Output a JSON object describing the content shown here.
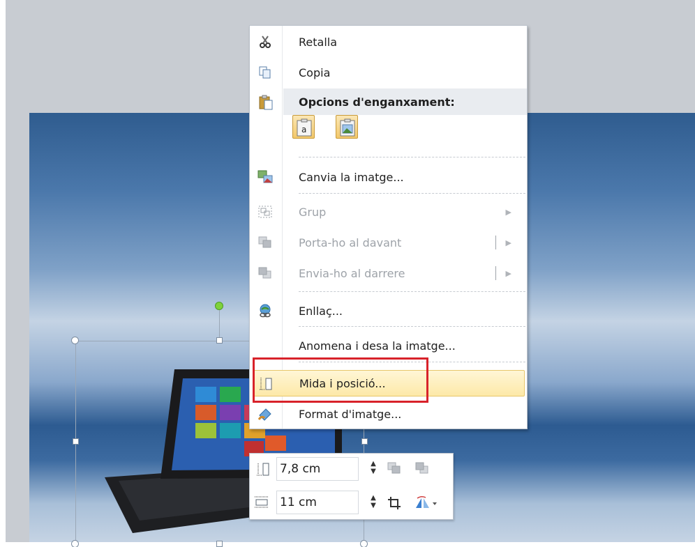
{
  "menu": {
    "items": [
      {
        "label": "Retalla",
        "icon": "scissors-icon"
      },
      {
        "label": "Copia",
        "icon": "copy-icon"
      },
      {
        "label": "Opcions d'enganxament:",
        "icon": "paste-icon"
      },
      {
        "label": "Canvia la imatge...",
        "icon": "change-picture-icon"
      },
      {
        "label": "Grup",
        "icon": "group-icon",
        "disabled": true
      },
      {
        "label": "Porta-ho al davant",
        "icon": "bring-forward-icon",
        "disabled": true
      },
      {
        "label": "Envia-ho al darrere",
        "icon": "send-backward-icon",
        "disabled": true
      },
      {
        "label": "Enllaç...",
        "icon": "hyperlink-icon"
      },
      {
        "label": "Anomena i desa la imatge...",
        "icon": ""
      },
      {
        "label": "Mida i posició...",
        "icon": "size-position-icon",
        "highlighted": true
      },
      {
        "label": "Format d'imatge...",
        "icon": "format-picture-icon"
      }
    ],
    "paste_options": [
      "keep-text-only-icon",
      "picture-icon"
    ]
  },
  "mini_toolbar": {
    "height_value": "7,8 cm",
    "width_value": "11 cm",
    "icons": [
      "height-icon",
      "width-icon",
      "bring-forward-icon",
      "send-backward-icon",
      "crop-icon",
      "rotate-icon"
    ]
  },
  "colors": {
    "highlight_box": "#d8222a",
    "menu_hover": "#fde9a8",
    "rotation_handle": "#7fd23a"
  }
}
